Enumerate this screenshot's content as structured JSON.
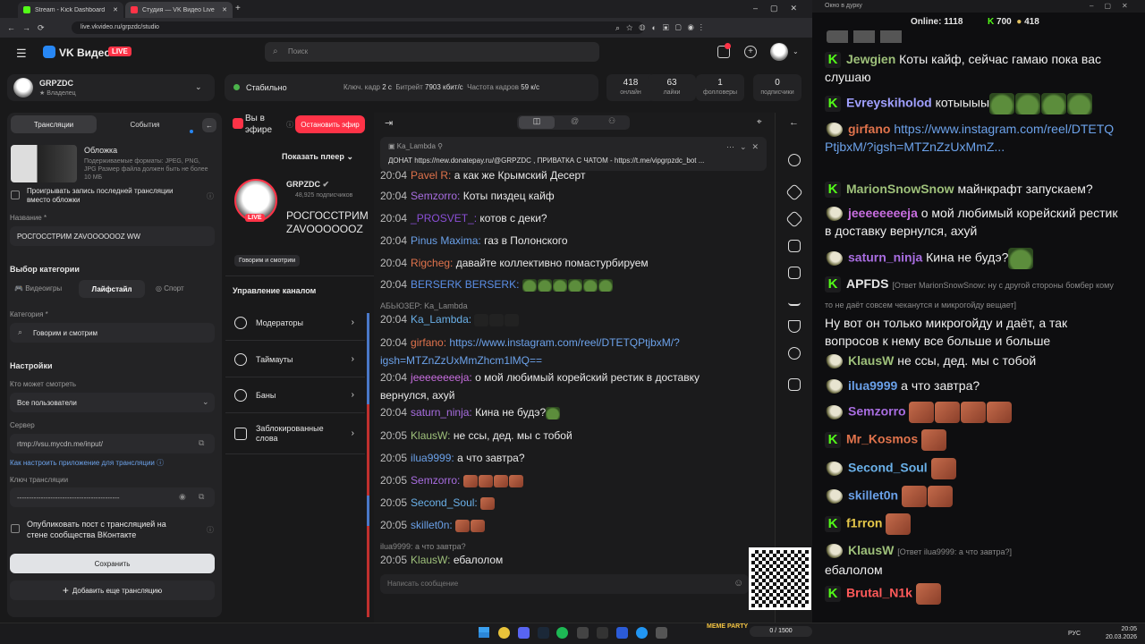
{
  "browser": {
    "tabs": [
      {
        "title": "Stream - Kick Dashboard"
      },
      {
        "title": "Студия — VK Видео Live"
      }
    ],
    "url": "live.vkvideo.ru/grpzdc/studio"
  },
  "vk": {
    "logo_text": "VK Видео",
    "live_badge": "LIVE",
    "search_placeholder": "Поиск",
    "account": {
      "name": "GRPZDC",
      "role": "Владелец"
    },
    "status": {
      "label": "Стабильно",
      "keyframe_label": "Ключ. кадр",
      "keyframe_value": "2 с",
      "bitrate_label": "Битрейт",
      "bitrate_value": "7903 кбит/с",
      "fps_label": "Частота кадров",
      "fps_value": "59 к/с"
    },
    "stats": [
      {
        "value": "418",
        "label": "онлайн"
      },
      {
        "value": "63",
        "label": "лайки"
      },
      {
        "value": "1",
        "label": "фолловеры"
      },
      {
        "value": "0",
        "label": "подписчики"
      }
    ],
    "left": {
      "tab_streams": "Трансляции",
      "tab_events": "События",
      "cover_title": "Обложка",
      "cover_hint": "Подерживаемые форматы: JPEG, PNG, JPG Размер файла должен быть не более 10 МБ",
      "replay_label": "Проигрывать запись последней трансляции вместо обложки",
      "name_label": "Название *",
      "name_value": "РОСГОССТРИМ ZAVOOOOOOZ WW",
      "category_title": "Выбор категории",
      "cat_games": "Видеоигры",
      "cat_lifestyle": "Лайфстайл",
      "cat_sport": "Спорт",
      "category_label": "Категория *",
      "category_value": "Говорим и смотрим",
      "settings_title": "Настройки",
      "who_can_watch_label": "Кто может смотреть",
      "who_can_watch_value": "Все пользователи",
      "server_label": "Сервер",
      "server_value": "rtmp://vsu.mycdn.me/input/",
      "setup_link": "Как настроить приложение для трансляции",
      "key_label": "Ключ трансляции",
      "key_value": "-------------------------------------------",
      "publish_label": "Опубликовать пост с трансляцией на стене сообщества ВКонтакте",
      "save_button": "Сохранить",
      "add_button": "Добавить еще трансляцию"
    },
    "middle": {
      "on_air": "Вы в эфире",
      "stop_button": "Остановить эфир",
      "show_player": "Показать плеер",
      "channel_name": "GRPZDC",
      "subscribers": "48,925 подписчиков",
      "stream_title": "РОСГОССТРИМ ZAVOOOOOOZ WW",
      "category_tag": "Говорим и смотрим",
      "live_badge": "LIVE",
      "manage_title": "Управление каналом",
      "menu": [
        "Модераторы",
        "Таймауты",
        "Баны",
        "Заблокированные слова"
      ]
    },
    "chat": {
      "pinned_user": "Ka_Lambda",
      "pinned_text": "ДОНАТ https://new.donatepay.ru/@GRPZDC , ПРИВАТКА С ЧАТОМ - https://t.me/vipgrpzdc_bot ...",
      "input_placeholder": "Написать сообщение",
      "messages": [
        {
          "time": "20:04",
          "user": "Pavel R:",
          "color": "#e0734c",
          "text": "а как же Крымский Десерт"
        },
        {
          "time": "20:04",
          "user": "Semzorro:",
          "color": "#a86de0",
          "text": "Коты пиздец кайф"
        },
        {
          "time": "20:04",
          "user": "_PROSVET_:",
          "color": "#8a4fd6",
          "text": "котов с деки?"
        },
        {
          "time": "20:04",
          "user": "Pinus Maxima:",
          "color": "#6aa0e8",
          "text": "газ в Полонского"
        },
        {
          "time": "20:04",
          "user": "Rigcheg:",
          "color": "#e0734c",
          "text": "давайте коллективно помастурбируем"
        },
        {
          "time": "20:04",
          "user": "BERSERK BERSERK:",
          "color": "#5b8fe8",
          "text": ""
        },
        {
          "time": "20:04",
          "user": "Ka_Lambda:",
          "color": "#6ab0e8",
          "text": "",
          "reply": "АБЬЮЗЕР: Ka_Lambda"
        },
        {
          "time": "20:04",
          "user": "girfano:",
          "color": "#e0734c",
          "text": "https://www.instagram.com/reel/DTETQPtjbxM/?igsh=MTZnZzUxMmZhcm1lMQ=="
        },
        {
          "time": "20:04",
          "user": "jeeeeeeeeja:",
          "color": "#c86ee0",
          "text": "о мой любимый корейский рестик в доставку вернулся, ахуй"
        },
        {
          "time": "20:04",
          "user": "saturn_ninja:",
          "color": "#a86de0",
          "text": "Кина не будэ?"
        },
        {
          "time": "20:05",
          "user": "KlausW:",
          "color": "#9ec07a",
          "text": "не ссы, дед. мы с тобой"
        },
        {
          "time": "20:05",
          "user": "ilua9999:",
          "color": "#6aa0e8",
          "text": "а что завтра?"
        },
        {
          "time": "20:05",
          "user": "Semzorro:",
          "color": "#a86de0",
          "text": ""
        },
        {
          "time": "20:05",
          "user": "Second_Soul:",
          "color": "#6ab0e8",
          "text": ""
        },
        {
          "time": "20:05",
          "user": "skillet0n:",
          "color": "#6aa0e8",
          "text": ""
        },
        {
          "time": "20:05",
          "user": "KlausW:",
          "color": "#9ec07a",
          "text": "ебалолом",
          "reply": "ilua9999: а что завтра?"
        }
      ]
    }
  },
  "kick": {
    "window_title": "Окно в дурку",
    "online_label": "Online:",
    "online_value": "1118",
    "viewers_a": "700",
    "viewers_b": "418",
    "messages": [
      {
        "badge": "kick",
        "user": "Jewgien",
        "color": "#9ec07a",
        "text": "Коты кайф, сейчас гамаю пока вас слушаю"
      },
      {
        "badge": "kick",
        "user": "Evreyskiholod",
        "color": "#a0a0ff",
        "text": "котыыыы"
      },
      {
        "badge": "vk",
        "user": "girfano",
        "color": "#e0734c",
        "text": "https://www.instagram.com/reel/DTETQPtjbxM/?igsh=MTZnZzUxMmZ..."
      },
      {
        "badge": "kick",
        "user": "MarionSnowSnow",
        "color": "#9ec07a",
        "text": "майнкрафт запускаем?"
      },
      {
        "badge": "vk",
        "user": "jeeeeeeeeja",
        "color": "#c86ee0",
        "text": "о мой любимый корейский рестик в доставку вернулся, ахуй"
      },
      {
        "badge": "vk",
        "user": "saturn_ninja",
        "color": "#a86de0",
        "text": "Кина не будэ?"
      },
      {
        "badge": "kick",
        "user": "APFDS",
        "color": "#e6e6e6",
        "reply": "[Ответ MarionSnowSnow: ну с другой стороны бомбер кому то не даёт совсем чеканутся и микрогойду вещает]",
        "text": "Ну вот он только микрогойду и даёт, а так вопросов к нему все больше и больше"
      },
      {
        "badge": "vk",
        "user": "KlausW",
        "color": "#9ec07a",
        "text": "не ссы, дед. мы с тобой"
      },
      {
        "badge": "vk",
        "user": "ilua9999",
        "color": "#6aa0e8",
        "text": "а что завтра?"
      },
      {
        "badge": "vk",
        "user": "Semzorro",
        "color": "#a86de0",
        "text": ""
      },
      {
        "badge": "kick",
        "user": "Mr_Kosmos",
        "color": "#e0734c",
        "text": ""
      },
      {
        "badge": "vk",
        "user": "Second_Soul",
        "color": "#6ab0e8",
        "text": ""
      },
      {
        "badge": "vk",
        "user": "skillet0n",
        "color": "#6aa0e8",
        "text": ""
      },
      {
        "badge": "kick",
        "user": "f1rron",
        "color": "#e6c84a",
        "text": ""
      },
      {
        "badge": "vk",
        "user": "KlausW",
        "color": "#9ec07a",
        "reply": "[Ответ ilua9999: а что завтра?]",
        "text": "ебалолом"
      },
      {
        "badge": "kick",
        "user": "Brutal_N1k",
        "color": "#ff5a5a",
        "text": ""
      }
    ]
  },
  "overlay": {
    "qr_label": "MEME PARTY",
    "counter": "0 / 1500"
  },
  "taskbar": {
    "lang": "РУС",
    "time": "20:05",
    "date": "20.03.2026"
  },
  "colors": {
    "vk_blue": "#2787f5",
    "live_red": "#ff3347",
    "kick_green": "#53fc18",
    "status_green": "#4bb34b"
  }
}
